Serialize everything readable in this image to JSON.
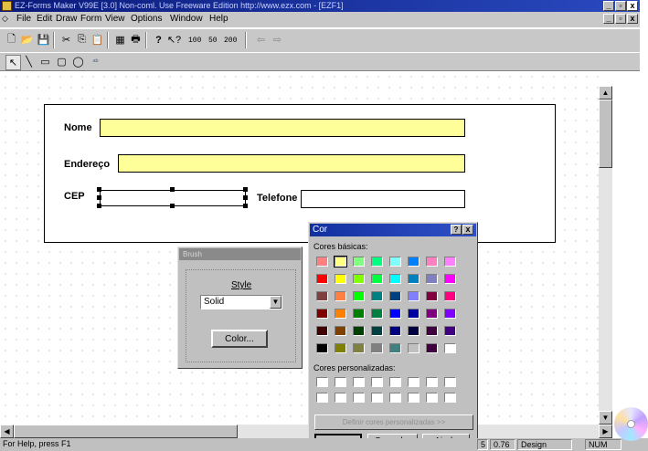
{
  "window": {
    "title": "EZ-Forms Maker V99E [3.0] Non-coml. Use Freeware Edition   http://www.ezx.com - [EZF1]",
    "controls": {
      "minimize": "_",
      "restore": "▫",
      "close": "x"
    }
  },
  "menu": [
    "File",
    "Edit",
    "Draw",
    "Form",
    "View",
    "Options",
    "Window",
    "Help"
  ],
  "toolbar": {
    "zoom": [
      "100",
      "50",
      "200"
    ]
  },
  "form": {
    "fields": {
      "nome": "Nome",
      "endereco": "Endereço",
      "cep": "CEP",
      "telefone": "Telefone"
    },
    "colors": {
      "field_fill": "#ffff99"
    }
  },
  "brush": {
    "title": "Brush",
    "style_label": "Style",
    "style_value": "Solid",
    "color_button": "Color..."
  },
  "color_dialog": {
    "title": "Cor",
    "help": "?",
    "close": "x",
    "basic_label": "Cores básicas:",
    "custom_label": "Cores personalizadas:",
    "define_button": "Definir cores personalizadas >>",
    "ok": "OK",
    "cancel": "Cancelar",
    "help_button": "Ajuda",
    "basic_colors": [
      [
        "#ff8080",
        "#ffff80",
        "#80ff80",
        "#00ff80",
        "#80ffff",
        "#0080ff",
        "#ff80c0",
        "#ff80ff"
      ],
      [
        "#ff0000",
        "#ffff00",
        "#80ff00",
        "#00ff40",
        "#00ffff",
        "#0080c0",
        "#8080c0",
        "#ff00ff"
      ],
      [
        "#804040",
        "#ff8040",
        "#00ff00",
        "#008080",
        "#004080",
        "#8080ff",
        "#800040",
        "#ff0080"
      ],
      [
        "#800000",
        "#ff8000",
        "#008000",
        "#008040",
        "#0000ff",
        "#0000a0",
        "#800080",
        "#8000ff"
      ],
      [
        "#400000",
        "#804000",
        "#004000",
        "#004040",
        "#000080",
        "#000040",
        "#400040",
        "#400080"
      ],
      [
        "#000000",
        "#808000",
        "#808040",
        "#808080",
        "#408080",
        "#c0c0c0",
        "#400040",
        "#ffffff"
      ]
    ]
  },
  "status": {
    "help": "For Help, press F1",
    "zoom": "0.76",
    "mode": "Design",
    "num": "NUM",
    "page": "5"
  }
}
